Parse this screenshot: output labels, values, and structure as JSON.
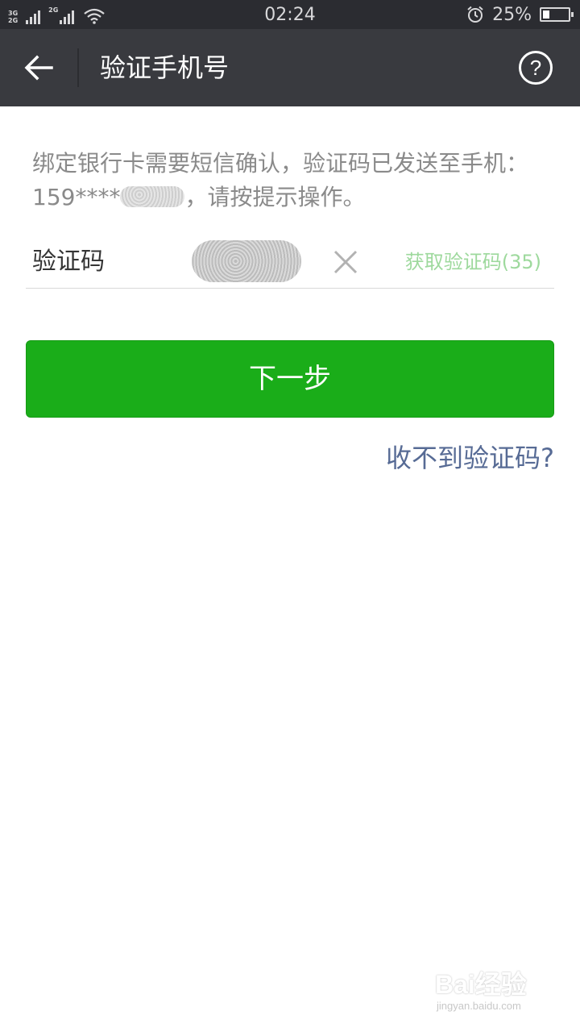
{
  "status_bar": {
    "net1_top": "3G",
    "net1_bottom": "2G",
    "net2": "2G",
    "time": "02:24",
    "battery_percent_text": "25%",
    "battery_level": 0.25,
    "icons": [
      "signal-bars-icon",
      "wifi-icon",
      "alarm-clock-icon",
      "battery-icon"
    ]
  },
  "title_bar": {
    "title": "验证手机号",
    "back_icon": "arrow-left-icon",
    "help_label": "?"
  },
  "content": {
    "description_prefix": "绑定银行卡需要短信确认，验证码已发送至手机：159****",
    "description_suffix": "，请按提示操作。",
    "code_label": "验证码",
    "code_value": "",
    "get_code_label": "获取验证码(35)",
    "next_button_label": "下一步",
    "no_code_link": "收不到验证码?"
  },
  "watermark": {
    "main": "Bai经验",
    "sub": "jingyan.baidu.com"
  },
  "colors": {
    "status_bg": "#2b2c31",
    "title_bg": "#393a3f",
    "primary_green": "#1aad19",
    "disabled_green_text": "#9ed99d",
    "link_blue": "#576b95"
  }
}
